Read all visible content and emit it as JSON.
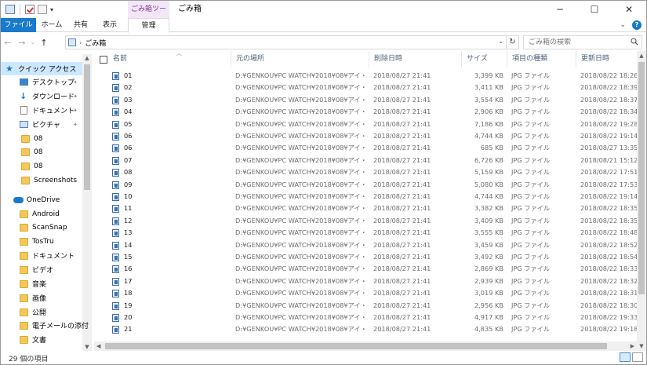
{
  "title_bar": {
    "context_tab_group": "ごみ箱ツール",
    "window_title": "ごみ箱"
  },
  "ribbon": {
    "tabs": [
      "ファイル",
      "ホーム",
      "共有",
      "表示",
      "管理"
    ]
  },
  "address_bar": {
    "location": "ごみ箱",
    "search_placeholder": "ごみ箱の検索"
  },
  "nav_pane": {
    "items": [
      {
        "label": "クイック アクセス",
        "icon": "star-icon",
        "pinned": false,
        "selected": true
      },
      {
        "label": "デスクトップ",
        "icon": "desktop-icon",
        "pinned": true
      },
      {
        "label": "ダウンロード",
        "icon": "download-icon",
        "pinned": true
      },
      {
        "label": "ドキュメント",
        "icon": "document-icon",
        "pinned": true
      },
      {
        "label": "ピクチャ",
        "icon": "pictures-icon",
        "pinned": true
      },
      {
        "label": "08",
        "icon": "folder-icon"
      },
      {
        "label": "08",
        "icon": "folder-icon"
      },
      {
        "label": "08",
        "icon": "folder-icon"
      },
      {
        "label": "Screenshots",
        "icon": "folder-icon"
      },
      {
        "label": "OneDrive",
        "icon": "onedrive-icon"
      },
      {
        "label": "Android",
        "icon": "folder-icon"
      },
      {
        "label": "ScanSnap",
        "icon": "folder-icon"
      },
      {
        "label": "TosTru",
        "icon": "folder-icon"
      },
      {
        "label": "ドキュメント",
        "icon": "folder-icon"
      },
      {
        "label": "ビデオ",
        "icon": "folder-icon"
      },
      {
        "label": "音楽",
        "icon": "folder-icon"
      },
      {
        "label": "画像",
        "icon": "folder-icon"
      },
      {
        "label": "公開",
        "icon": "folder-icon"
      },
      {
        "label": "電子メールの添付",
        "icon": "folder-icon"
      },
      {
        "label": "文書",
        "icon": "folder-icon"
      }
    ]
  },
  "file_list": {
    "columns": [
      "名前",
      "元の場所",
      "削除日時",
      "サイズ",
      "項目の種類",
      "更新日時"
    ],
    "rows": [
      {
        "name": "01",
        "path": "D:¥GENKOU¥PC WATCH¥2018¥08¥アイ・オ...",
        "deleted": "2018/08/27 21:41",
        "size": "3,399 KB",
        "type": "JPG ファイル",
        "modified": "2018/08/22 18:26"
      },
      {
        "name": "02",
        "path": "D:¥GENKOU¥PC WATCH¥2018¥08¥アイ・オ...",
        "deleted": "2018/08/27 21:41",
        "size": "3,411 KB",
        "type": "JPG ファイル",
        "modified": "2018/08/22 18:39"
      },
      {
        "name": "03",
        "path": "D:¥GENKOU¥PC WATCH¥2018¥08¥アイ・オ...",
        "deleted": "2018/08/27 21:41",
        "size": "3,554 KB",
        "type": "JPG ファイル",
        "modified": "2018/08/22 18:37"
      },
      {
        "name": "04",
        "path": "D:¥GENKOU¥PC WATCH¥2018¥08¥アイ・オ...",
        "deleted": "2018/08/27 21:41",
        "size": "2,906 KB",
        "type": "JPG ファイル",
        "modified": "2018/08/22 18:34"
      },
      {
        "name": "05",
        "path": "D:¥GENKOU¥PC WATCH¥2018¥08¥アイ・オ...",
        "deleted": "2018/08/27 21:41",
        "size": "7,186 KB",
        "type": "JPG ファイル",
        "modified": "2018/08/22 19:28"
      },
      {
        "name": "06",
        "path": "D:¥GENKOU¥PC WATCH¥2018¥08¥アイ・オ...",
        "deleted": "2018/08/27 21:41",
        "size": "4,744 KB",
        "type": "JPG ファイル",
        "modified": "2018/08/22 19:14"
      },
      {
        "name": "06",
        "path": "D:¥GENKOU¥PC WATCH¥2018¥08¥アイ・オ...",
        "deleted": "2018/08/27 21:41",
        "size": "685 KB",
        "type": "JPG ファイル",
        "modified": "2018/08/27 13:35"
      },
      {
        "name": "07",
        "path": "D:¥GENKOU¥PC WATCH¥2018¥08¥アイ・オ...",
        "deleted": "2018/08/27 21:41",
        "size": "6,726 KB",
        "type": "JPG ファイル",
        "modified": "2018/08/21 15:12"
      },
      {
        "name": "08",
        "path": "D:¥GENKOU¥PC WATCH¥2018¥08¥アイ・オ...",
        "deleted": "2018/08/27 21:41",
        "size": "5,159 KB",
        "type": "JPG ファイル",
        "modified": "2018/08/22 17:51"
      },
      {
        "name": "09",
        "path": "D:¥GENKOU¥PC WATCH¥2018¥08¥アイ・オ...",
        "deleted": "2018/08/27 21:41",
        "size": "5,080 KB",
        "type": "JPG ファイル",
        "modified": "2018/08/22 17:53"
      },
      {
        "name": "10",
        "path": "D:¥GENKOU¥PC WATCH¥2018¥08¥アイ・オ...",
        "deleted": "2018/08/27 21:41",
        "size": "4,744 KB",
        "type": "JPG ファイル",
        "modified": "2018/08/22 19:14"
      },
      {
        "name": "11",
        "path": "D:¥GENKOU¥PC WATCH¥2018¥08¥アイ・オ...",
        "deleted": "2018/08/27 21:41",
        "size": "3,382 KB",
        "type": "JPG ファイル",
        "modified": "2018/08/22 18:35"
      },
      {
        "name": "12",
        "path": "D:¥GENKOU¥PC WATCH¥2018¥08¥アイ・オ...",
        "deleted": "2018/08/27 21:41",
        "size": "3,409 KB",
        "type": "JPG ファイル",
        "modified": "2018/08/22 18:35"
      },
      {
        "name": "13",
        "path": "D:¥GENKOU¥PC WATCH¥2018¥08¥アイ・オ...",
        "deleted": "2018/08/27 21:41",
        "size": "3,555 KB",
        "type": "JPG ファイル",
        "modified": "2018/08/22 18:48"
      },
      {
        "name": "14",
        "path": "D:¥GENKOU¥PC WATCH¥2018¥08¥アイ・オ...",
        "deleted": "2018/08/27 21:41",
        "size": "3,459 KB",
        "type": "JPG ファイル",
        "modified": "2018/08/22 18:52"
      },
      {
        "name": "15",
        "path": "D:¥GENKOU¥PC WATCH¥2018¥08¥アイ・オ...",
        "deleted": "2018/08/27 21:41",
        "size": "3,492 KB",
        "type": "JPG ファイル",
        "modified": "2018/08/22 18:54"
      },
      {
        "name": "16",
        "path": "D:¥GENKOU¥PC WATCH¥2018¥08¥アイ・オ...",
        "deleted": "2018/08/27 21:41",
        "size": "2,869 KB",
        "type": "JPG ファイル",
        "modified": "2018/08/22 18:33"
      },
      {
        "name": "17",
        "path": "D:¥GENKOU¥PC WATCH¥2018¥08¥アイ・オ...",
        "deleted": "2018/08/27 21:41",
        "size": "2,939 KB",
        "type": "JPG ファイル",
        "modified": "2018/08/22 18:32"
      },
      {
        "name": "18",
        "path": "D:¥GENKOU¥PC WATCH¥2018¥08¥アイ・オ...",
        "deleted": "2018/08/27 21:41",
        "size": "3,019 KB",
        "type": "JPG ファイル",
        "modified": "2018/08/22 18:31"
      },
      {
        "name": "19",
        "path": "D:¥GENKOU¥PC WATCH¥2018¥08¥アイ・オ...",
        "deleted": "2018/08/27 21:41",
        "size": "2,956 KB",
        "type": "JPG ファイル",
        "modified": "2018/08/22 18:30"
      },
      {
        "name": "20",
        "path": "D:¥GENKOU¥PC WATCH¥2018¥08¥アイ・オ...",
        "deleted": "2018/08/27 21:41",
        "size": "4,917 KB",
        "type": "JPG ファイル",
        "modified": "2018/08/22 19:33"
      },
      {
        "name": "21",
        "path": "D:¥GENKOU¥PC WATCH¥2018¥08¥アイ・オ...",
        "deleted": "2018/08/27 21:41",
        "size": "4,835 KB",
        "type": "JPG ファイル",
        "modified": "2018/08/22 19:18"
      }
    ]
  },
  "status_bar": {
    "item_count": "29 個の項目"
  },
  "colors": {
    "accent": "#1979ca",
    "selection": "#cce8ff",
    "header_text": "#4c607a",
    "context_tab": "#f2e6f7"
  }
}
